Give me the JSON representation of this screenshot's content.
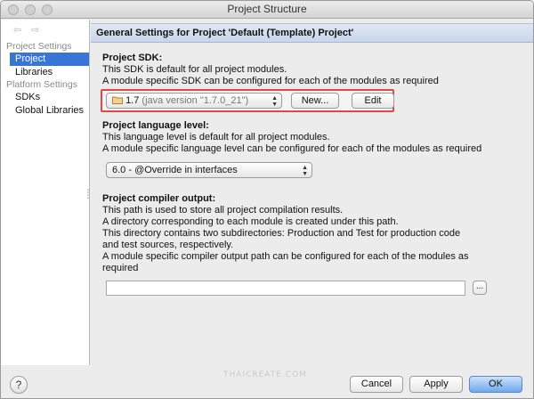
{
  "window": {
    "title": "Project Structure"
  },
  "nav": {
    "back_icon": "arrow-left-icon",
    "forward_icon": "arrow-right-icon"
  },
  "sidebar": {
    "project_header": "Project Settings",
    "project_items": [
      "Project",
      "Libraries"
    ],
    "platform_header": "Platform Settings",
    "platform_items": [
      "SDKs",
      "Global Libraries"
    ],
    "selected": "Project"
  },
  "panel": {
    "title": "General Settings for Project 'Default (Template) Project'"
  },
  "sdk": {
    "heading": "Project SDK:",
    "line1": "This SDK is default for all project modules.",
    "line2": "A module specific SDK can be configured for each of the modules as required",
    "combo_value": "1.7",
    "combo_detail": "(java version \"1.7.0_21\")",
    "new_label": "New...",
    "edit_label": "Edit"
  },
  "language": {
    "heading": "Project language level:",
    "line1": "This language level is default for all project modules.",
    "line2": "A module specific language level can be configured for each of the modules as required",
    "combo_value": "6.0 - @Override in interfaces"
  },
  "compiler": {
    "heading": "Project compiler output:",
    "line1": "This path is used to store all project compilation results.",
    "line2": "A directory corresponding to each module is created under this path.",
    "line3": "This directory contains two subdirectories: Production and Test for production code",
    "line4": "and test sources, respectively.",
    "line5": "A module specific compiler output path can be configured for each of the modules as",
    "line6": "required",
    "path_value": "",
    "browse_label": "..."
  },
  "footer": {
    "help_label": "?",
    "watermark": "THAICREATE.COM",
    "cancel_label": "Cancel",
    "apply_label": "Apply",
    "ok_label": "OK"
  }
}
